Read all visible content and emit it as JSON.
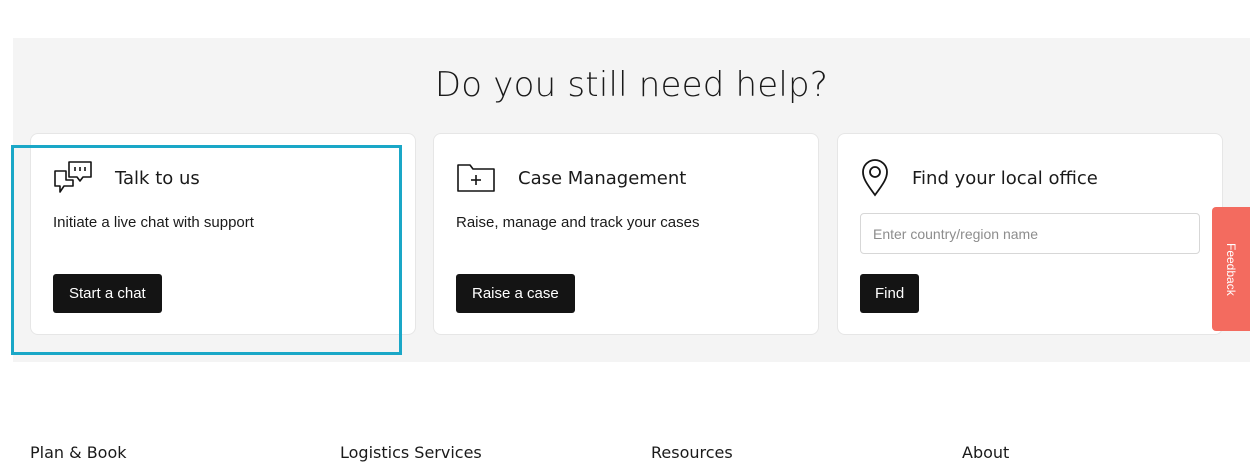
{
  "help": {
    "title": "Do you still need help?",
    "cards": [
      {
        "icon": "chat-bubbles-icon",
        "title": "Talk to us",
        "description": "Initiate a live chat with support",
        "button_label": "Start a chat"
      },
      {
        "icon": "folder-plus-icon",
        "title": "Case Management",
        "description": "Raise, manage and track your cases",
        "button_label": "Raise a case"
      },
      {
        "icon": "location-pin-icon",
        "title": "Find your local office",
        "input_placeholder": "Enter country/region name",
        "input_value": "",
        "button_label": "Find"
      }
    ],
    "highlight_color": "#1aa7c7"
  },
  "feedback": {
    "label": "Feedback",
    "color": "#f36b5f"
  },
  "footer": {
    "columns": [
      "Plan & Book",
      "Logistics Services",
      "Resources",
      "About"
    ]
  }
}
